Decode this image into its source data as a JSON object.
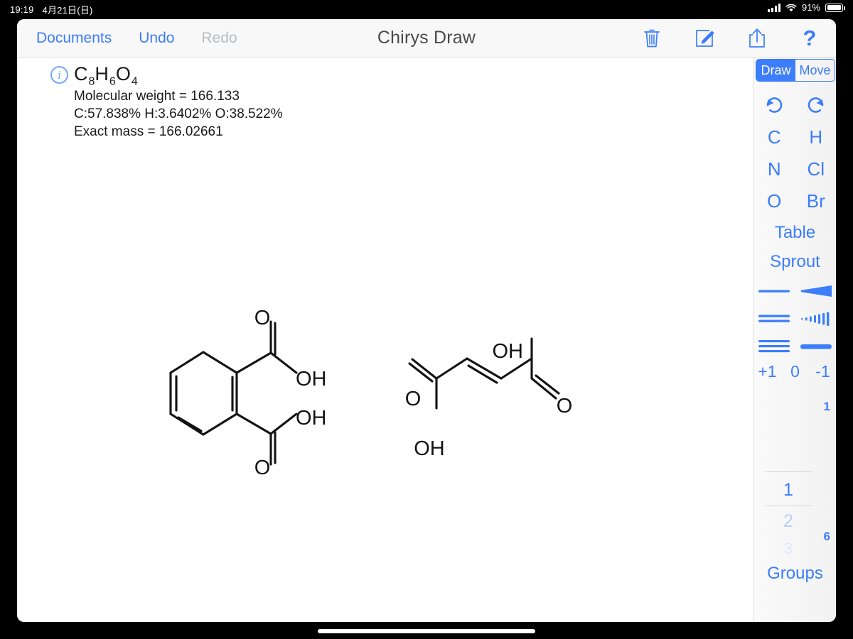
{
  "statusbar": {
    "time": "19:19",
    "date": "4月21日(日)",
    "battery_pct": "91%",
    "signal_icon": "cellular-bars-icon",
    "wifi_icon": "wifi-icon",
    "battery_icon": "battery-icon"
  },
  "toolbar": {
    "documents_label": "Documents",
    "undo_label": "Undo",
    "redo_label": "Redo",
    "title": "Chirys Draw",
    "icons": {
      "trash": "trash-icon",
      "compose": "compose-icon",
      "share": "share-icon",
      "help": "?"
    }
  },
  "info": {
    "icon": "info-icon",
    "formula": {
      "parts": [
        {
          "el": "C",
          "sub": "8"
        },
        {
          "el": "H",
          "sub": "6"
        },
        {
          "el": "O",
          "sub": "4"
        }
      ],
      "text": "C8H6O4"
    },
    "molecular_weight": "Molecular weight = 166.133",
    "composition": "C:57.838% H:3.6402% O:38.522%",
    "exact_mass": "Exact mass = 166.02661"
  },
  "panel": {
    "mode": {
      "draw": "Draw",
      "move": "Move",
      "selected": "Draw"
    },
    "undo_icon": "undo-arrow-icon",
    "redo_icon": "redo-arrow-icon",
    "elements": [
      "C",
      "H",
      "N",
      "Cl",
      "O",
      "Br"
    ],
    "table_label": "Table",
    "sprout_label": "Sprout",
    "bonds": [
      {
        "name": "single-bond",
        "kind": "single"
      },
      {
        "name": "wedge-bond",
        "kind": "wedge"
      },
      {
        "name": "double-bond",
        "kind": "double"
      },
      {
        "name": "hash-bond",
        "kind": "hash"
      },
      {
        "name": "triple-bond",
        "kind": "triple"
      },
      {
        "name": "bold-bond",
        "kind": "bold"
      }
    ],
    "charges": [
      "+1",
      "0",
      "-1"
    ],
    "charge_value": "1",
    "ring_size": "6",
    "picker": {
      "selected": "1",
      "next": "2",
      "after": "3"
    },
    "groups_label": "Groups"
  },
  "molecules": [
    {
      "name": "phthalic-acid",
      "labels": [
        "OH",
        "O",
        "OH",
        "O"
      ]
    },
    {
      "name": "fumaric-acid",
      "labels": [
        "OH",
        "O",
        "OH",
        "O"
      ]
    }
  ],
  "colors": {
    "accent": "#3b7dfb",
    "accent_disabled": "#b9bcc0",
    "title": "#4a4a4a",
    "toolbar_bg": "#f8f8f8",
    "panel_bg": "#f5f5f5",
    "ink": "#1a1a1a"
  }
}
